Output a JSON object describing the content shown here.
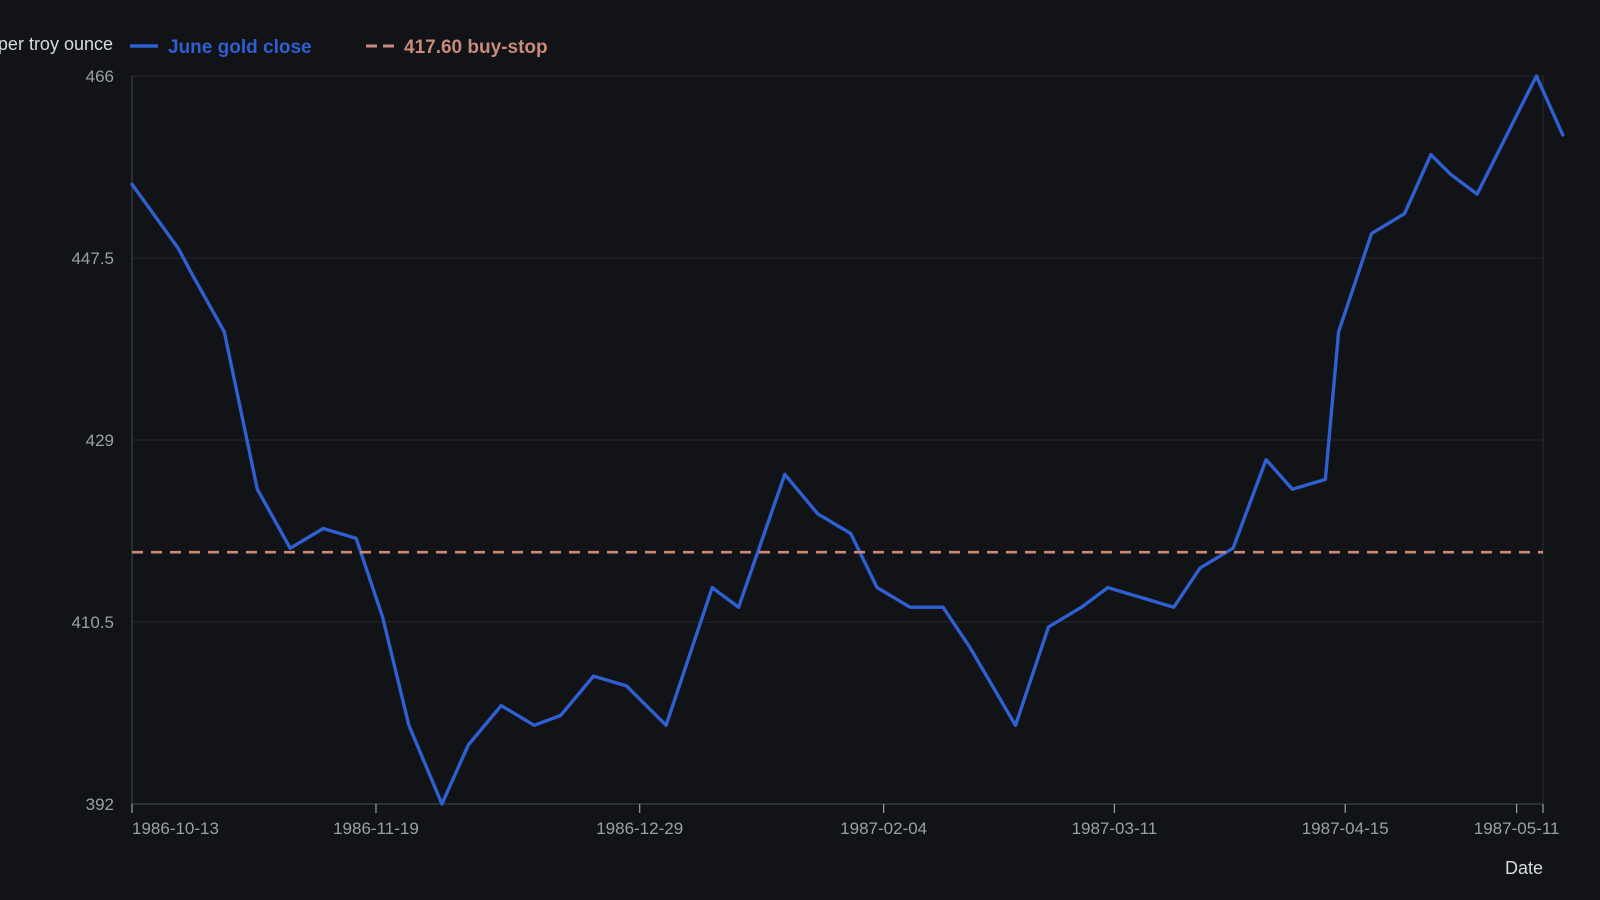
{
  "chart_data": {
    "type": "line",
    "title": "",
    "ylabel": "per troy ounce",
    "xlabel": "Date",
    "ylim": [
      392,
      466
    ],
    "y_ticks": [
      "392",
      "410.5",
      "429",
      "447.5",
      "466"
    ],
    "x_ticks": [
      "1986-10-13",
      "1986-11-19",
      "1986-12-29",
      "1987-02-04",
      "1987-03-11",
      "1987-04-15",
      "1987-05-11"
    ],
    "xlim": [
      "1986-10-13",
      "1987-05-15"
    ],
    "grid": "horizontal",
    "legend_position": "top-left",
    "series": [
      {
        "name": "June gold close",
        "color": "#2f5fd0",
        "style": "solid",
        "points": [
          [
            "1986-10-13",
            455.0
          ],
          [
            "1986-10-20",
            448.5
          ],
          [
            "1986-10-22",
            446.0
          ],
          [
            "1986-10-27",
            440.0
          ],
          [
            "1986-11-01",
            424.0
          ],
          [
            "1986-11-06",
            418.0
          ],
          [
            "1986-11-11",
            420.0
          ],
          [
            "1986-11-16",
            419.0
          ],
          [
            "1986-11-20",
            411.0
          ],
          [
            "1986-11-24",
            400.0
          ],
          [
            "1986-11-29",
            392.0
          ],
          [
            "1986-12-03",
            398.0
          ],
          [
            "1986-12-08",
            402.0
          ],
          [
            "1986-12-13",
            400.0
          ],
          [
            "1986-12-17",
            401.0
          ],
          [
            "1986-12-22",
            405.0
          ],
          [
            "1986-12-27",
            404.0
          ],
          [
            "1987-01-02",
            400.0
          ],
          [
            "1987-01-09",
            414.0
          ],
          [
            "1987-01-13",
            412.0
          ],
          [
            "1987-01-20",
            425.5
          ],
          [
            "1987-01-25",
            421.5
          ],
          [
            "1987-01-30",
            419.5
          ],
          [
            "1987-02-03",
            414.0
          ],
          [
            "1987-02-08",
            412.0
          ],
          [
            "1987-02-13",
            412.0
          ],
          [
            "1987-02-17",
            408.0
          ],
          [
            "1987-02-24",
            400.0
          ],
          [
            "1987-03-01",
            410.0
          ],
          [
            "1987-03-06",
            412.0
          ],
          [
            "1987-03-10",
            414.0
          ],
          [
            "1987-03-20",
            412.0
          ],
          [
            "1987-03-24",
            416.0
          ],
          [
            "1987-03-29",
            418.0
          ],
          [
            "1987-04-03",
            427.0
          ],
          [
            "1987-04-07",
            424.0
          ],
          [
            "1987-04-12",
            425.0
          ],
          [
            "1987-04-14",
            440.0
          ],
          [
            "1987-04-19",
            450.0
          ],
          [
            "1987-04-24",
            452.0
          ],
          [
            "1987-04-28",
            458.0
          ],
          [
            "1987-05-01",
            456.0
          ],
          [
            "1987-05-05",
            454.0
          ],
          [
            "1987-05-11",
            462.0
          ],
          [
            "1987-05-14",
            466.0
          ],
          [
            "1987-05-18",
            460.0
          ]
        ]
      },
      {
        "name": "417.60 buy-stop",
        "color": "#c98a78",
        "style": "dashed",
        "value": 417.6
      }
    ]
  }
}
